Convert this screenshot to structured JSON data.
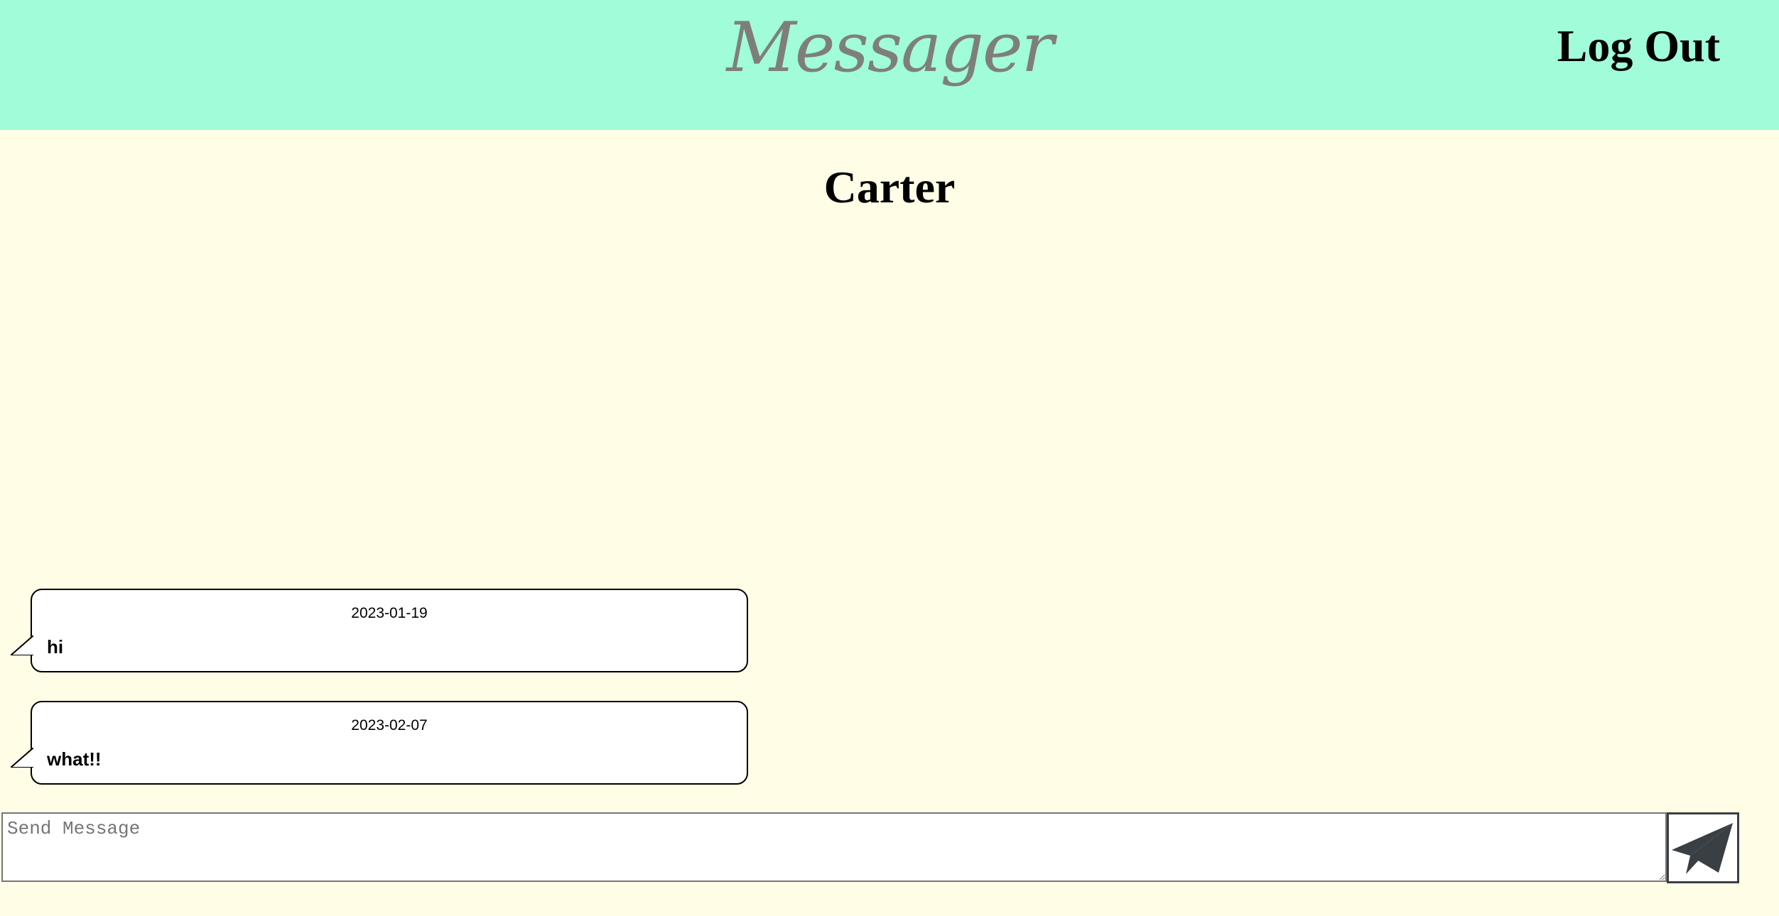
{
  "header": {
    "brand": "Messager",
    "logout_label": "Log Out"
  },
  "conversation": {
    "contact_name": "Carter",
    "messages": [
      {
        "date": "2023-01-19",
        "text": "hi"
      },
      {
        "date": "2023-02-07",
        "text": "what!!"
      }
    ]
  },
  "composer": {
    "placeholder": "Send Message",
    "value": ""
  },
  "icons": {
    "send": "paper-plane-icon"
  },
  "colors": {
    "header_bg": "#a0fcd9",
    "page_bg": "#fffde6",
    "brand_text": "#7f7f7a",
    "bubble_bg": "#ffffff",
    "send_icon": "#3a3f43"
  }
}
